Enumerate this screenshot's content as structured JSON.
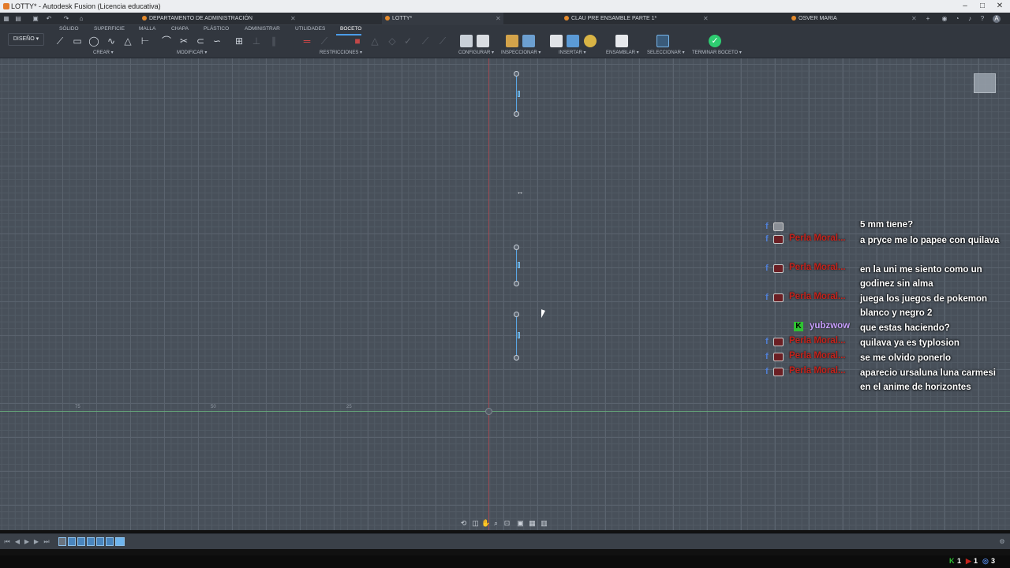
{
  "window": {
    "title": "LOTTY* - Autodesk Fusion (Licencia educativa)"
  },
  "tabs": [
    {
      "label": "DEPARTAMENTO DE ADMINISTRACIÓN",
      "active": false
    },
    {
      "label": "LOTTY*",
      "active": true
    },
    {
      "label": "CLAU PRE ENSAMBLE PARTE 1*",
      "active": false
    },
    {
      "label": "OSVER MARIA",
      "active": false
    }
  ],
  "toolbar": {
    "workspace": "DISEÑO ▾",
    "workspace_tabs": [
      "SÓLIDO",
      "SUPERFICIE",
      "MALLA",
      "CHAPA",
      "PLÁSTICO",
      "ADMINISTRAR",
      "UTILIDADES",
      "BOCETO"
    ],
    "groups": {
      "crear": "CREAR ▾",
      "modificar": "MODIFICAR ▾",
      "restricciones": "RESTRICCIONES ▾",
      "configurar": "CONFIGURAR ▾",
      "inspeccionar": "INSPECCIONAR ▾",
      "insertar": "INSERTAR ▾",
      "ensamblar": "ENSAMBLAR ▾",
      "seleccionar": "SELECCIONAR ▾",
      "terminar": "TERMINAR BOCETO ▾"
    }
  },
  "canvas": {
    "ruler_labels": [
      "75",
      "50",
      "25"
    ]
  },
  "chat": [
    {
      "user": "",
      "text": "5 mm tiene?",
      "source": "facebook"
    },
    {
      "user": "Perla Moral...",
      "text": "a pryce me lo papee con quilava",
      "source": "facebook"
    },
    {
      "user": "Perla Moral...",
      "text": "en la uni me siento como un godinez sin alma",
      "source": "facebook"
    },
    {
      "user": "Perla Moral...",
      "text": "juega los juegos de pokemon blanco y negro 2",
      "source": "facebook"
    },
    {
      "user": "yubzwow",
      "text": "que estas haciendo?",
      "source": "kick"
    },
    {
      "user": "Perla Moral...",
      "text": "quilava ya es typlosion",
      "source": "facebook"
    },
    {
      "user": "Perla Moral...",
      "text": "se me olvido ponerlo",
      "source": "facebook"
    },
    {
      "user": "Perla Moral...",
      "text": "aparecio ursaluna luna carmesi en el anime de horizontes",
      "source": "facebook"
    }
  ],
  "taskbar": {
    "kick_count": "1",
    "viewers_count": "1",
    "other_count": "3"
  },
  "colors": {
    "accent": "#4b9ce8",
    "sketch": "#5aa7e6",
    "chat_user": "#c4231c",
    "kick_user": "#c9a0ff",
    "finish": "#2ecc71"
  }
}
